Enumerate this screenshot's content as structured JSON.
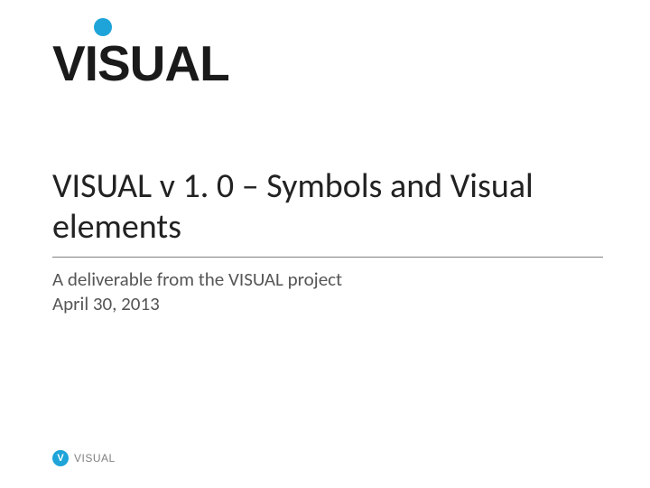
{
  "logo": {
    "text": "VISUAL"
  },
  "title": "VISUAL v 1. 0 – Symbols and Visual elements",
  "subtitle": {
    "line1": "A deliverable from the VISUAL project",
    "line2": "April 30, 2013"
  },
  "footer": {
    "badge": "V",
    "text": "VISUAL"
  }
}
